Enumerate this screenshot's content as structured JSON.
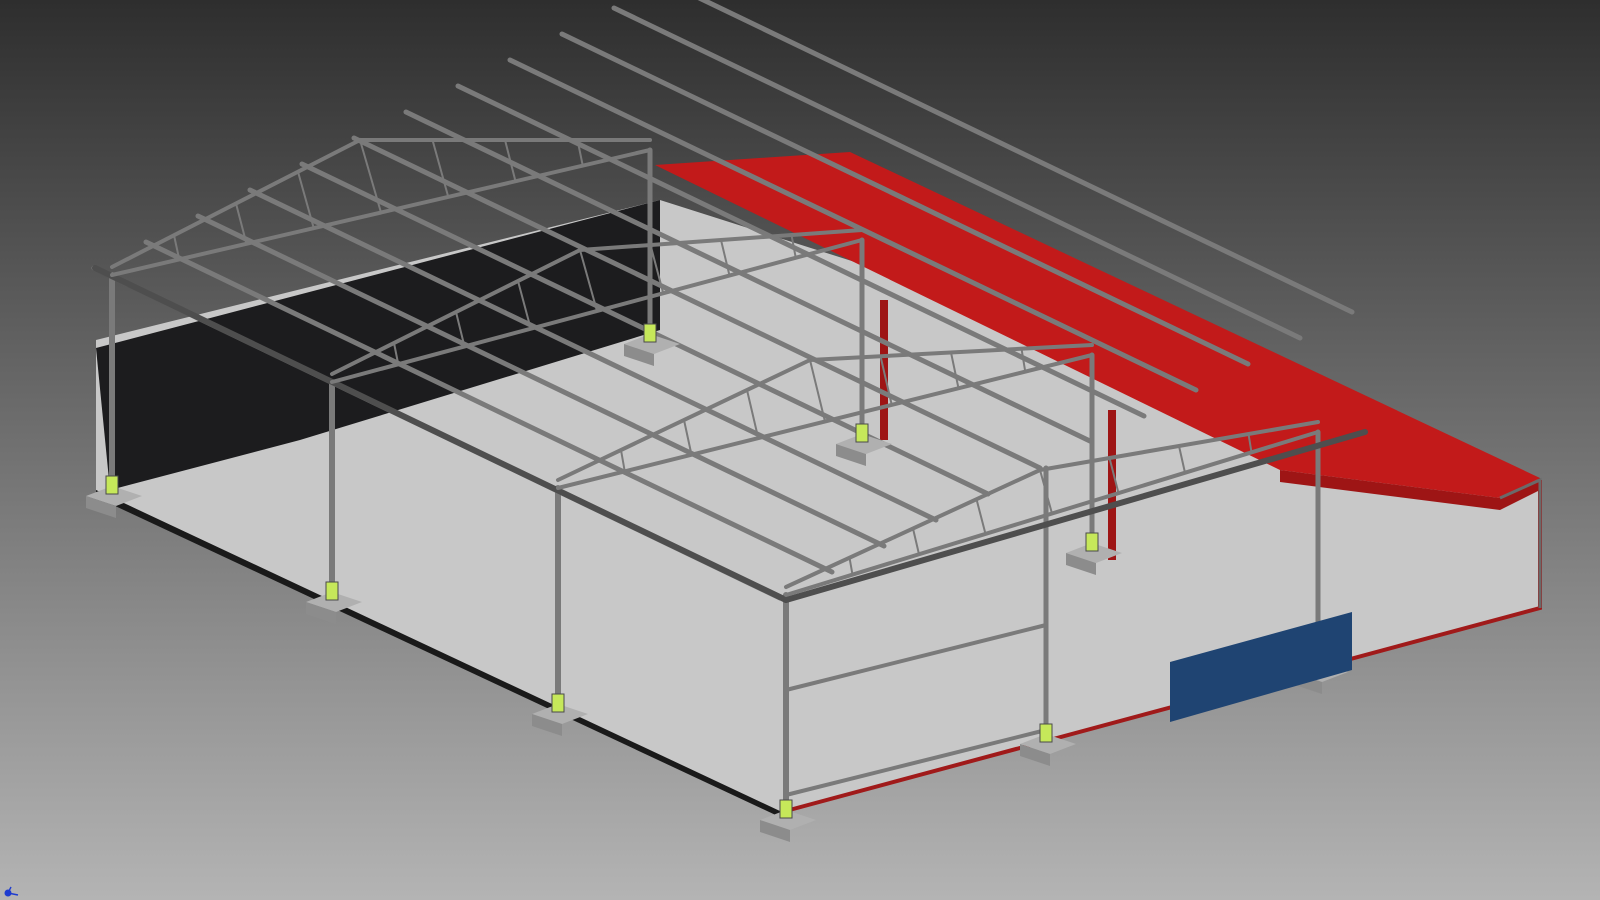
{
  "viewport": {
    "background_top": "#2e2e2e",
    "background_bottom": "#b4b4b4"
  },
  "colors": {
    "floor": "#c8c8c8",
    "floor_edge": "#1a1a1a",
    "back_wall": "#1c1c1e",
    "steel": "#7a7a7a",
    "steel_dark": "#4e4e4e",
    "red_roof": "#c21a1a",
    "red_roof_shade": "#9e1515",
    "red_trim": "#a01a1a",
    "blue_panel": "#1f4472",
    "footing": "#b0b0b0",
    "footing_shade": "#8c8c8c",
    "anchor_plate": "#c6e85a",
    "triad": "#1e3cd0"
  },
  "scene": {
    "model": "steel-frame-warehouse",
    "view": "isometric",
    "icons": {
      "view_triad": "axis-triad-icon"
    }
  }
}
